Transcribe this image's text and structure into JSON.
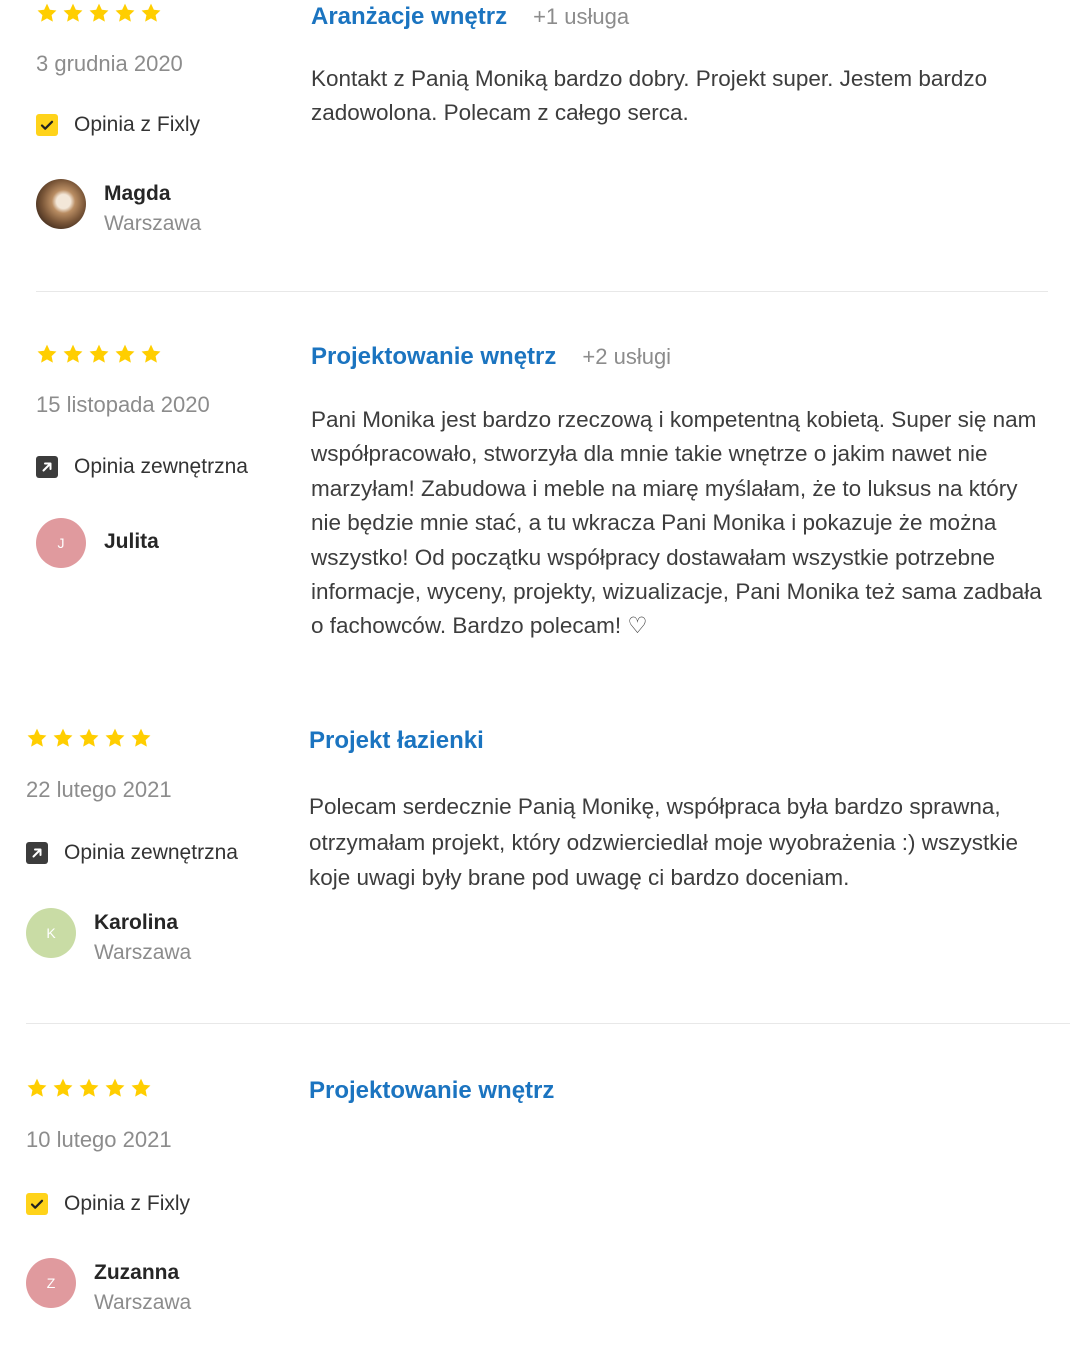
{
  "colors": {
    "star": "#ffce00",
    "title": "#1b74c0",
    "muted": "#8c8c8c",
    "fixly_badge": "#ffd31a"
  },
  "reviews": [
    {
      "rating": 5,
      "date": "3 grudnia 2020",
      "source_icon": "checkmark-icon",
      "source": "Opinia z Fixly",
      "user": {
        "name": "Magda",
        "city": "Warszawa",
        "avatar_initial": ""
      },
      "title": "Aranżacje wnętrz",
      "extra": "+1 usługa",
      "text": "Kontakt z Panią Moniką bardzo dobry. Projekt super. Jestem bardzo zadowolona. Polecam z całego serca."
    },
    {
      "rating": 5,
      "date": "15 listopada 2020",
      "source_icon": "external-link-icon",
      "source": "Opinia zewnętrzna",
      "user": {
        "name": "Julita",
        "city": "",
        "avatar_initial": "J"
      },
      "title": "Projektowanie wnętrz",
      "extra": "+2 usługi",
      "text": "Pani Monika jest bardzo rzeczową i kompetentną kobietą. Super się nam współpracowało, stworzyła dla mnie takie wnętrze o jakim nawet nie marzyłam! Zabudowa i meble na miarę myślałam, że to luksus na który nie będzie mnie stać, a tu wkracza Pani Monika i pokazuje że można wszystko! Od początku współpracy dostawałam wszystkie potrzebne informacje, wyceny, projekty, wizualizacje, Pani Monika też sama zadbała o fachowców. Bardzo polecam! ♡"
    },
    {
      "rating": 5,
      "date": "22 lutego 2021",
      "source_icon": "external-link-icon",
      "source": "Opinia zewnętrzna",
      "user": {
        "name": "Karolina",
        "city": "Warszawa",
        "avatar_initial": "K"
      },
      "title": "Projekt łazienki",
      "extra": "",
      "text": "Polecam serdecznie Panią Monikę, współpraca była bardzo sprawna, otrzymałam projekt, który odzwierciedlał moje wyobrażenia :) wszystkie koje uwagi były brane pod uwagę ci bardzo doceniam."
    },
    {
      "rating": 5,
      "date": "10 lutego 2021",
      "source_icon": "checkmark-icon",
      "source": "Opinia z Fixly",
      "user": {
        "name": "Zuzanna",
        "city": "Warszawa",
        "avatar_initial": "Z"
      },
      "title": "Projektowanie wnętrz",
      "extra": "",
      "text": ""
    }
  ]
}
